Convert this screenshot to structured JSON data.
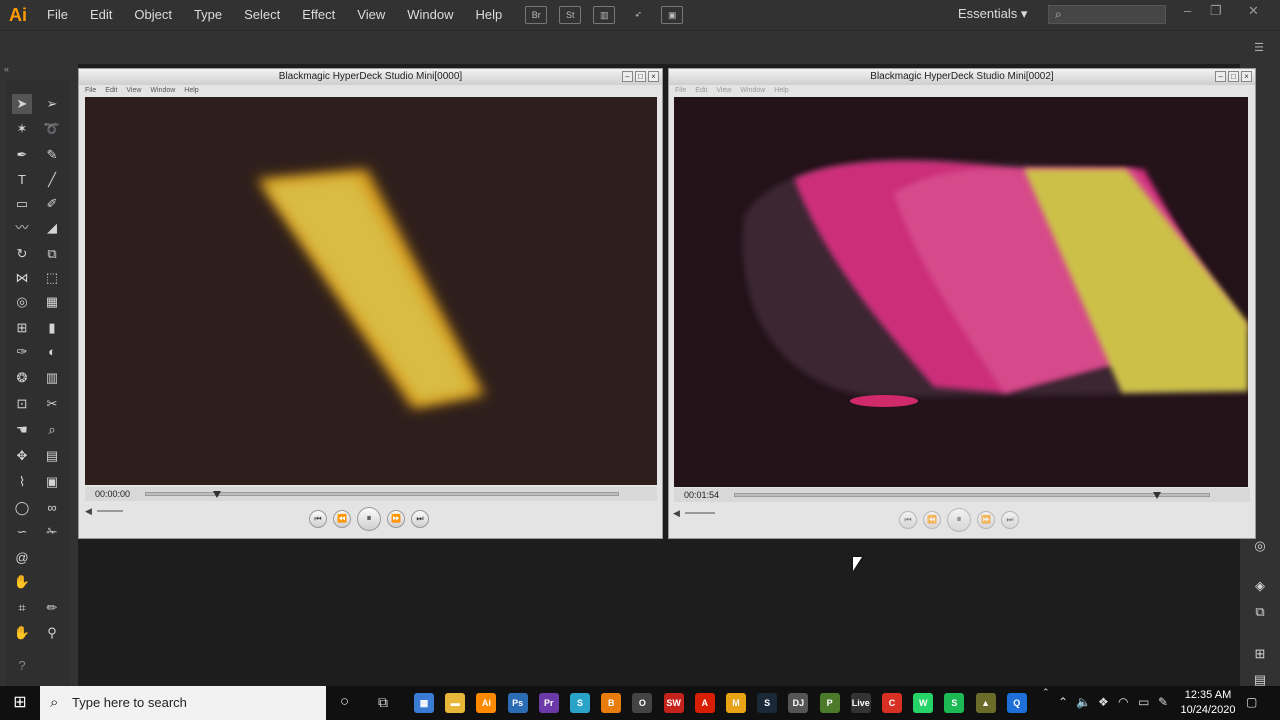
{
  "app": {
    "logo": "Ai"
  },
  "menu": [
    "File",
    "Edit",
    "Object",
    "Type",
    "Select",
    "Effect",
    "View",
    "Window",
    "Help"
  ],
  "menubar_icons": [
    {
      "name": "bridge-icon",
      "label": "Br"
    },
    {
      "name": "stock-icon",
      "label": "St"
    }
  ],
  "workspace": {
    "label": "Essentials",
    "chevron": "▾"
  },
  "search": {
    "placeholder": ""
  },
  "window_controls": {
    "minimize": "–",
    "restore": "❐",
    "close": "✕"
  },
  "player_menu": [
    "File",
    "Edit",
    "View",
    "Window",
    "Help"
  ],
  "players": [
    {
      "title": "Blackmagic HyperDeck Studio Mini[0000]",
      "timecode": "00:00:00",
      "progress": 0.15
    },
    {
      "title": "Blackmagic HyperDeck Studio Mini[0002]",
      "timecode": "00:01:54",
      "progress": 0.89
    }
  ],
  "transport": {
    "prev": "⏮",
    "rewind": "⏪",
    "pause": "⏸",
    "forward": "⏩",
    "next": "⏭",
    "volume": "◀"
  },
  "taskbar": {
    "search_placeholder": "Type here to search",
    "apps": [
      {
        "name": "calculator-icon",
        "label": "▦",
        "color": "#3a7bd5"
      },
      {
        "name": "file-explorer-icon",
        "label": "▬",
        "color": "#e8b73a"
      },
      {
        "name": "illustrator-icon",
        "label": "Ai",
        "color": "#ff8a00"
      },
      {
        "name": "photoshop-icon",
        "label": "Ps",
        "color": "#2b6cb5"
      },
      {
        "name": "premiere-icon",
        "label": "Pr",
        "color": "#6b3aa8"
      },
      {
        "name": "sketchup-icon",
        "label": "S",
        "color": "#2aa3c8"
      },
      {
        "name": "blender-icon",
        "label": "B",
        "color": "#e87d0d"
      },
      {
        "name": "oculus-icon",
        "label": "O",
        "color": "#444444"
      },
      {
        "name": "swift-icon",
        "label": "SW",
        "color": "#c4231b"
      },
      {
        "name": "acrobat-icon",
        "label": "A",
        "color": "#d81e05"
      },
      {
        "name": "mail-icon",
        "label": "M",
        "color": "#e8a317"
      },
      {
        "name": "steam-icon",
        "label": "S",
        "color": "#1b2838"
      },
      {
        "name": "virtualdj-icon",
        "label": "DJ",
        "color": "#555555"
      },
      {
        "name": "plants-icon",
        "label": "P",
        "color": "#4a7a2a"
      },
      {
        "name": "live-icon",
        "label": "Live",
        "color": "#333333"
      },
      {
        "name": "chrome-icon",
        "label": "C",
        "color": "#d93025"
      },
      {
        "name": "whatsapp-icon",
        "label": "W",
        "color": "#25d366"
      },
      {
        "name": "spotify-icon",
        "label": "S",
        "color": "#1db954"
      },
      {
        "name": "app-yellow-icon",
        "label": "▲",
        "color": "#6b6b2a"
      },
      {
        "name": "quicktime-icon",
        "label": "Q",
        "color": "#1e6fd9"
      }
    ],
    "time": "12:35 AM",
    "date": "10/24/2020"
  }
}
